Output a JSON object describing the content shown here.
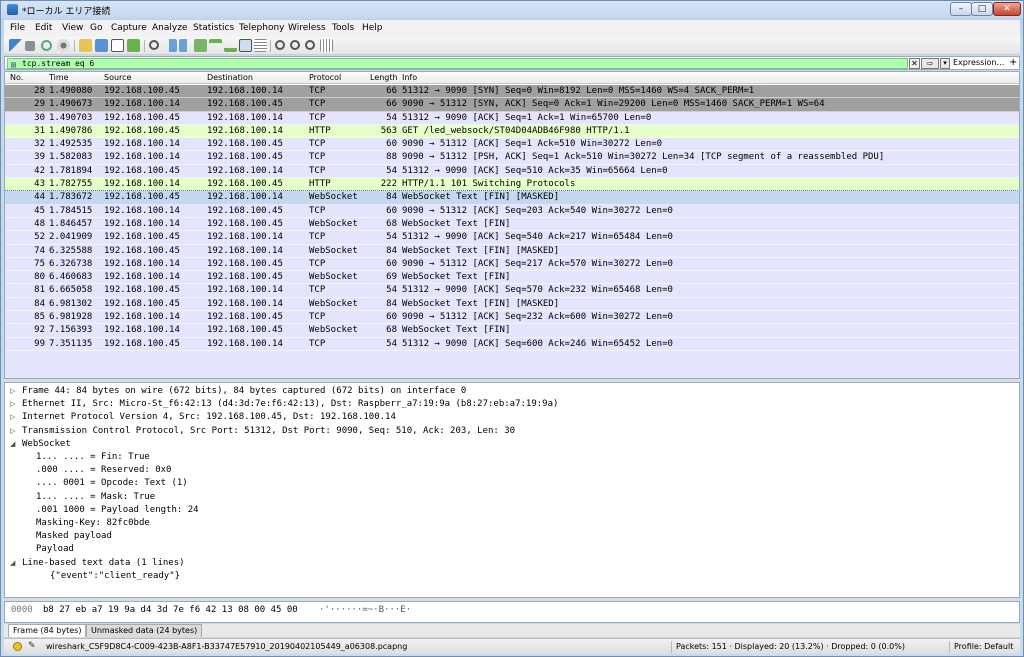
{
  "window": {
    "title": "*ローカル エリア接続"
  },
  "menu": [
    "File",
    "Edit",
    "View",
    "Go",
    "Capture",
    "Analyze",
    "Statistics",
    "Telephony",
    "Wireless",
    "Tools",
    "Help"
  ],
  "filter": {
    "value": "tcp.stream eq 6",
    "expression_label": "Expression…",
    "plus_label": "+"
  },
  "packet_list": {
    "headers": {
      "no": "No.",
      "time": "Time",
      "source": "Source",
      "destination": "Destination",
      "protocol": "Protocol",
      "length": "Length",
      "info": "Info"
    },
    "rows": [
      {
        "no": "28",
        "time": "1.490080",
        "src": "192.168.100.45",
        "dst": "192.168.100.14",
        "proto": "TCP",
        "len": "66",
        "info": "51312 → 9090 [SYN] Seq=0 Win=8192 Len=0 MSS=1460 WS=4 SACK_PERM=1",
        "bg": "#a0a0a0"
      },
      {
        "no": "29",
        "time": "1.490673",
        "src": "192.168.100.14",
        "dst": "192.168.100.45",
        "proto": "TCP",
        "len": "66",
        "info": "9090 → 51312 [SYN, ACK] Seq=0 Ack=1 Win=29200 Len=0 MSS=1460 SACK_PERM=1 WS=64",
        "bg": "#a0a0a0"
      },
      {
        "no": "30",
        "time": "1.490703",
        "src": "192.168.100.45",
        "dst": "192.168.100.14",
        "proto": "TCP",
        "len": "54",
        "info": "51312 → 9090 [ACK] Seq=1 Ack=1 Win=65700 Len=0",
        "bg": "#e4e4fc"
      },
      {
        "no": "31",
        "time": "1.490786",
        "src": "192.168.100.45",
        "dst": "192.168.100.14",
        "proto": "HTTP",
        "len": "563",
        "info": "GET /led_websock/ST04D04ADB46F980 HTTP/1.1",
        "bg": "#e4ffc7"
      },
      {
        "no": "32",
        "time": "1.492535",
        "src": "192.168.100.14",
        "dst": "192.168.100.45",
        "proto": "TCP",
        "len": "60",
        "info": "9090 → 51312 [ACK] Seq=1 Ack=510 Win=30272 Len=0",
        "bg": "#e4e4fc"
      },
      {
        "no": "39",
        "time": "1.582083",
        "src": "192.168.100.14",
        "dst": "192.168.100.45",
        "proto": "TCP",
        "len": "88",
        "info": "9090 → 51312 [PSH, ACK] Seq=1 Ack=510 Win=30272 Len=34 [TCP segment of a reassembled PDU]",
        "bg": "#e4e4fc"
      },
      {
        "no": "42",
        "time": "1.781894",
        "src": "192.168.100.45",
        "dst": "192.168.100.14",
        "proto": "TCP",
        "len": "54",
        "info": "51312 → 9090 [ACK] Seq=510 Ack=35 Win=65664 Len=0",
        "bg": "#e4e4fc"
      },
      {
        "no": "43",
        "time": "1.782755",
        "src": "192.168.100.14",
        "dst": "192.168.100.45",
        "proto": "HTTP",
        "len": "222",
        "info": "HTTP/1.1 101 Switching Protocols",
        "bg": "#e4ffc7"
      },
      {
        "no": "44",
        "time": "1.783672",
        "src": "192.168.100.45",
        "dst": "192.168.100.14",
        "proto": "WebSocket",
        "len": "84",
        "info": "WebSocket Text [FIN] [MASKED]",
        "bg": "#c4d8f2",
        "selected": true
      },
      {
        "no": "45",
        "time": "1.784515",
        "src": "192.168.100.14",
        "dst": "192.168.100.45",
        "proto": "TCP",
        "len": "60",
        "info": "9090 → 51312 [ACK] Seq=203 Ack=540 Win=30272 Len=0",
        "bg": "#e4e4fc"
      },
      {
        "no": "48",
        "time": "1.846457",
        "src": "192.168.100.14",
        "dst": "192.168.100.45",
        "proto": "WebSocket",
        "len": "68",
        "info": "WebSocket Text [FIN]",
        "bg": "#e4e4fc"
      },
      {
        "no": "52",
        "time": "2.041909",
        "src": "192.168.100.45",
        "dst": "192.168.100.14",
        "proto": "TCP",
        "len": "54",
        "info": "51312 → 9090 [ACK] Seq=540 Ack=217 Win=65484 Len=0",
        "bg": "#e4e4fc"
      },
      {
        "no": "74",
        "time": "6.325588",
        "src": "192.168.100.45",
        "dst": "192.168.100.14",
        "proto": "WebSocket",
        "len": "84",
        "info": "WebSocket Text [FIN] [MASKED]",
        "bg": "#e4e4fc"
      },
      {
        "no": "75",
        "time": "6.326738",
        "src": "192.168.100.14",
        "dst": "192.168.100.45",
        "proto": "TCP",
        "len": "60",
        "info": "9090 → 51312 [ACK] Seq=217 Ack=570 Win=30272 Len=0",
        "bg": "#e4e4fc"
      },
      {
        "no": "80",
        "time": "6.460683",
        "src": "192.168.100.14",
        "dst": "192.168.100.45",
        "proto": "WebSocket",
        "len": "69",
        "info": "WebSocket Text [FIN]",
        "bg": "#e4e4fc"
      },
      {
        "no": "81",
        "time": "6.665058",
        "src": "192.168.100.45",
        "dst": "192.168.100.14",
        "proto": "TCP",
        "len": "54",
        "info": "51312 → 9090 [ACK] Seq=570 Ack=232 Win=65468 Len=0",
        "bg": "#e4e4fc"
      },
      {
        "no": "84",
        "time": "6.981302",
        "src": "192.168.100.45",
        "dst": "192.168.100.14",
        "proto": "WebSocket",
        "len": "84",
        "info": "WebSocket Text [FIN] [MASKED]",
        "bg": "#e4e4fc"
      },
      {
        "no": "85",
        "time": "6.981928",
        "src": "192.168.100.14",
        "dst": "192.168.100.45",
        "proto": "TCP",
        "len": "60",
        "info": "9090 → 51312 [ACK] Seq=232 Ack=600 Win=30272 Len=0",
        "bg": "#e4e4fc"
      },
      {
        "no": "92",
        "time": "7.156393",
        "src": "192.168.100.14",
        "dst": "192.168.100.45",
        "proto": "WebSocket",
        "len": "68",
        "info": "WebSocket Text [FIN]",
        "bg": "#e4e4fc"
      },
      {
        "no": "99",
        "time": "7.351135",
        "src": "192.168.100.45",
        "dst": "192.168.100.14",
        "proto": "TCP",
        "len": "54",
        "info": "51312 → 9090 [ACK] Seq=600 Ack=246 Win=65452 Len=0",
        "bg": "#e4e4fc"
      }
    ]
  },
  "details": [
    {
      "text": "Frame 44: 84 bytes on wire (672 bits), 84 bytes captured (672 bits) on interface 0",
      "indent": 0,
      "arrow": "▷"
    },
    {
      "text": "Ethernet II, Src: Micro-St_f6:42:13 (d4:3d:7e:f6:42:13), Dst: Raspberr_a7:19:9a (b8:27:eb:a7:19:9a)",
      "indent": 0,
      "arrow": "▷"
    },
    {
      "text": "Internet Protocol Version 4, Src: 192.168.100.45, Dst: 192.168.100.14",
      "indent": 0,
      "arrow": "▷"
    },
    {
      "text": "Transmission Control Protocol, Src Port: 51312, Dst Port: 9090, Seq: 510, Ack: 203, Len: 30",
      "indent": 0,
      "arrow": "▷"
    },
    {
      "text": "WebSocket",
      "indent": 0,
      "arrow": "◢"
    },
    {
      "text": "1... .... = Fin: True",
      "indent": 1,
      "arrow": ""
    },
    {
      "text": ".000 .... = Reserved: 0x0",
      "indent": 1,
      "arrow": ""
    },
    {
      "text": ".... 0001 = Opcode: Text (1)",
      "indent": 1,
      "arrow": ""
    },
    {
      "text": "1... .... = Mask: True",
      "indent": 1,
      "arrow": ""
    },
    {
      "text": ".001 1000 = Payload length: 24",
      "indent": 1,
      "arrow": ""
    },
    {
      "text": "Masking-Key: 82fc0bde",
      "indent": 1,
      "arrow": ""
    },
    {
      "text": "Masked payload",
      "indent": 1,
      "arrow": ""
    },
    {
      "text": "Payload",
      "indent": 1,
      "arrow": ""
    },
    {
      "text": "Line-based text data (1 lines)",
      "indent": 0,
      "arrow": "◢"
    },
    {
      "text": "{\"event\":\"client_ready\"}",
      "indent": 2,
      "arrow": ""
    }
  ],
  "bytes": {
    "offset": "0000",
    "hex": "b8 27 eb a7 19 9a d4 3d  7e f6 42 13 08 00 45 00",
    "ascii": "·'······=~·B···E·"
  },
  "byte_tabs": [
    {
      "label": "Frame (84 bytes)",
      "active": true
    },
    {
      "label": "Unmasked data (24 bytes)",
      "active": false
    }
  ],
  "status": {
    "file": "wireshark_C5F9D8C4-C009-423B-A8F1-B33747E57910_20190402105449_a06308.pcapng",
    "packets": "Packets: 151 · Displayed: 20 (13.2%) · Dropped: 0 (0.0%)",
    "profile": "Profile: Default"
  },
  "window_buttons": {
    "min": "–",
    "max": "□",
    "close": "✕"
  },
  "colors": {
    "selected": "#c4d8f2",
    "tcp": "#e4e4fc",
    "http": "#e4ffc7",
    "syn": "#a0a0a0"
  }
}
